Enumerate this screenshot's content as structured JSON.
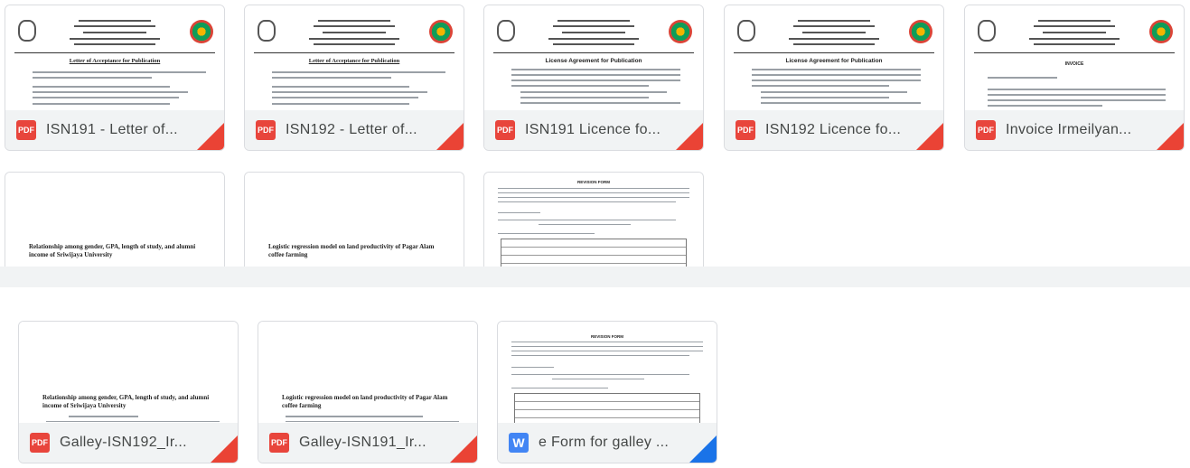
{
  "files": [
    {
      "name": "ISN191 - Letter of...",
      "type": "pdf",
      "thumb": {
        "title": "Letter of Acceptance for Publication"
      }
    },
    {
      "name": "ISN192 - Letter of...",
      "type": "pdf",
      "thumb": {
        "title": "Letter of Acceptance for Publication"
      }
    },
    {
      "name": "ISN191 Licence fo...",
      "type": "pdf",
      "thumb": {
        "title": "License Agreement for Publication"
      }
    },
    {
      "name": "ISN192 Licence fo...",
      "type": "pdf",
      "thumb": {
        "title": "License Agreement for Publication"
      }
    },
    {
      "name": "Invoice Irmeilyan...",
      "type": "pdf",
      "thumb": {
        "title": "INVOICE"
      }
    },
    {
      "name": "",
      "type": "pdf",
      "thumb": {
        "title": "Relationship among gender, GPA, length of study, and alumni income of Sriwijaya University"
      }
    },
    {
      "name": "",
      "type": "pdf",
      "thumb": {
        "title": "Logistic regression model on land productivity of Pagar Alam coffee farming"
      }
    },
    {
      "name": "",
      "type": "word",
      "thumb": {
        "title": "REVISION FORM"
      }
    },
    {
      "name": "Galley-ISN192_Ir...",
      "type": "pdf",
      "thumb": {
        "title": "Relationship among gender, GPA, length of study, and alumni income of Sriwijaya University"
      }
    },
    {
      "name": "Galley-ISN191_Ir...",
      "type": "pdf",
      "thumb": {
        "title": "Logistic regression model on land productivity of Pagar Alam coffee farming"
      }
    },
    {
      "name": "e Form for galley ...",
      "type": "word",
      "thumb": {
        "title": "REVISION FORM"
      }
    }
  ],
  "icons": {
    "pdf": "PDF",
    "word": "W"
  },
  "colors": {
    "pdf": "#ea4335",
    "word": "#4285f4",
    "label_bg": "#f1f3f4"
  }
}
